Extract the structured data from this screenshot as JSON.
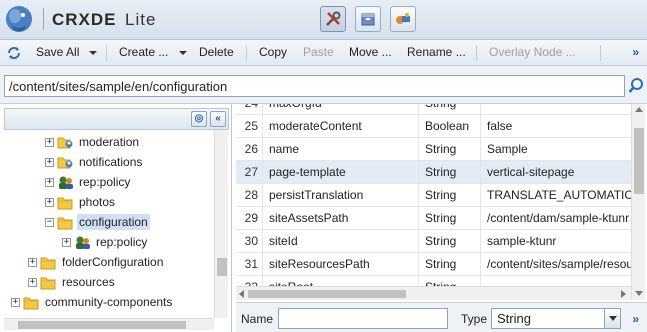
{
  "app": {
    "brand": "CRXDE",
    "brand_suffix": "Lite",
    "header_buttons": [
      {
        "icon": "tools-icon",
        "active": true
      },
      {
        "icon": "package-icon",
        "active": false
      },
      {
        "icon": "console-icon",
        "active": false
      }
    ]
  },
  "toolbar": {
    "save_all": "Save All",
    "create": "Create ...",
    "delete": "Delete",
    "copy": "Copy",
    "paste": "Paste",
    "move": "Move ...",
    "rename": "Rename ...",
    "overlay_node": "Overlay Node ...",
    "more": "»"
  },
  "path": {
    "value": "/content/sites/sample/en/configuration"
  },
  "tree": {
    "items": [
      {
        "label": "moderation",
        "indent": 3,
        "icon": "group-folder",
        "selected": false
      },
      {
        "label": "notifications",
        "indent": 3,
        "icon": "group-folder",
        "selected": false
      },
      {
        "label": "rep:policy",
        "indent": 3,
        "icon": "policy",
        "selected": false
      },
      {
        "label": "photos",
        "indent": 3,
        "icon": "folder",
        "selected": false
      },
      {
        "label": "configuration",
        "indent": 3,
        "icon": "folder",
        "selected": true,
        "expanded": true
      },
      {
        "label": "rep:policy",
        "indent": 4,
        "icon": "policy",
        "selected": false
      },
      {
        "label": "folderConfiguration",
        "indent": 2,
        "icon": "folder",
        "selected": false
      },
      {
        "label": "resources",
        "indent": 2,
        "icon": "folder",
        "selected": false
      },
      {
        "label": "community-components",
        "indent": 1,
        "icon": "folder",
        "selected": false
      }
    ]
  },
  "properties": {
    "rows": [
      {
        "num": "24",
        "name": "maxOrgId",
        "type": "String",
        "value": ""
      },
      {
        "num": "25",
        "name": "moderateContent",
        "type": "Boolean",
        "value": "false"
      },
      {
        "num": "26",
        "name": "name",
        "type": "String",
        "value": "Sample"
      },
      {
        "num": "27",
        "name": "page-template",
        "type": "String",
        "value": "vertical-sitepage",
        "highlight": true
      },
      {
        "num": "28",
        "name": "persistTranslation",
        "type": "String",
        "value": "TRANSLATE_AUTOMATIC"
      },
      {
        "num": "29",
        "name": "siteAssetsPath",
        "type": "String",
        "value": "/content/dam/sample-ktunr"
      },
      {
        "num": "30",
        "name": "siteId",
        "type": "String",
        "value": "sample-ktunr"
      },
      {
        "num": "31",
        "name": "siteResourcesPath",
        "type": "String",
        "value": "/content/sites/sample/resou"
      },
      {
        "num": "32",
        "name": "siteRoot",
        "type": "String",
        "value": ""
      }
    ]
  },
  "form": {
    "name_label": "Name",
    "name_value": "",
    "type_label": "Type",
    "type_value": "String",
    "more": "»"
  }
}
